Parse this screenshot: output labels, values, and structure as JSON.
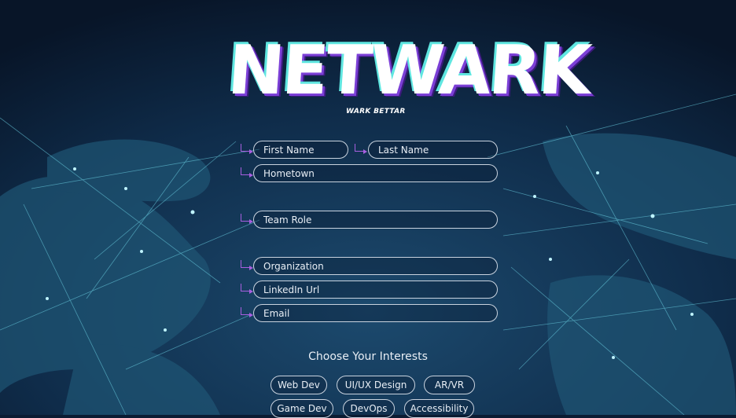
{
  "brand": {
    "logo_text": "NETWARK",
    "tagline": "WARK BETTAR"
  },
  "form": {
    "first_name_placeholder": "First Name",
    "last_name_placeholder": "Last Name",
    "hometown_placeholder": "Hometown",
    "team_role_placeholder": "Team Role",
    "organization_placeholder": "Organization",
    "linkedin_placeholder": "LinkedIn Url",
    "email_placeholder": "Email"
  },
  "interests": {
    "title": "Choose Your Interests",
    "options": [
      "Web Dev",
      "UI/UX Design",
      "AR/VR",
      "Game Dev",
      "DevOps",
      "Accessibility"
    ]
  },
  "colors": {
    "accent_cyan": "#5fe6e0",
    "accent_purple": "#a85fe0",
    "background": "#0b1c33"
  }
}
